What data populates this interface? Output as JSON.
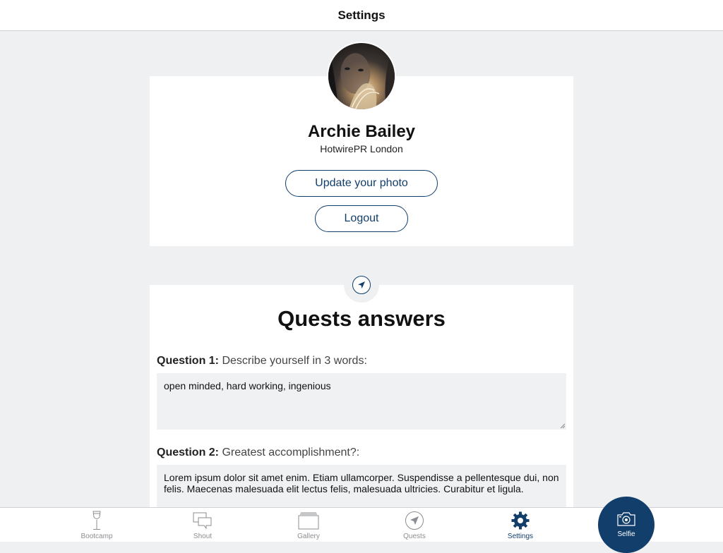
{
  "header": {
    "title": "Settings"
  },
  "profile": {
    "name": "Archie Bailey",
    "company": "HotwirePR London",
    "update_photo_label": "Update your photo",
    "logout_label": "Logout"
  },
  "quests": {
    "title": "Quests answers",
    "items": [
      {
        "label": "Question 1:",
        "text": "Describe yourself in 3 words:",
        "answer": "open minded, hard working, ingenious"
      },
      {
        "label": "Question 2:",
        "text": "Greatest accomplishment?:",
        "answer": "Lorem ipsum dolor sit amet enim. Etiam ullamcorper. Suspendisse a pellentesque dui, non felis. Maecenas malesuada elit lectus felis, malesuada ultricies. Curabitur et ligula."
      }
    ]
  },
  "tabs": [
    {
      "label": "Bootcamp",
      "icon": "wine-glass-icon"
    },
    {
      "label": "Shout",
      "icon": "chat-bubbles-icon"
    },
    {
      "label": "Gallery",
      "icon": "gallery-stack-icon"
    },
    {
      "label": "Quests",
      "icon": "compass-icon"
    },
    {
      "label": "Settings",
      "icon": "gear-icon",
      "active": true
    },
    {
      "label": "Selfie",
      "icon": "camera-icon"
    }
  ],
  "colors": {
    "accent": "#123e6b",
    "background": "#eff0f2",
    "inactive_tab": "#8a8d92"
  }
}
